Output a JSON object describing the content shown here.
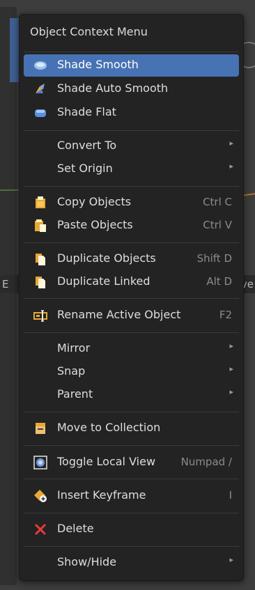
{
  "background": {
    "header_left": "E",
    "header_right": "ve"
  },
  "menu": {
    "title": "Object Context Menu",
    "items": [
      {
        "label": "Shade Smooth",
        "shortcut": "",
        "submenu": false,
        "icon": "shade-smooth-icon"
      },
      {
        "label": "Shade Auto Smooth",
        "shortcut": "",
        "submenu": false,
        "icon": "shade-auto-smooth-icon"
      },
      {
        "label": "Shade Flat",
        "shortcut": "",
        "submenu": false,
        "icon": "shade-flat-icon"
      },
      {
        "label": "Convert To",
        "shortcut": "",
        "submenu": true,
        "icon": ""
      },
      {
        "label": "Set Origin",
        "shortcut": "",
        "submenu": true,
        "icon": ""
      },
      {
        "label": "Copy Objects",
        "shortcut": "Ctrl C",
        "submenu": false,
        "icon": "copy-icon"
      },
      {
        "label": "Paste Objects",
        "shortcut": "Ctrl V",
        "submenu": false,
        "icon": "paste-icon"
      },
      {
        "label": "Duplicate Objects",
        "shortcut": "Shift D",
        "submenu": false,
        "icon": "duplicate-icon"
      },
      {
        "label": "Duplicate Linked",
        "shortcut": "Alt D",
        "submenu": false,
        "icon": "duplicate-linked-icon"
      },
      {
        "label": "Rename Active Object",
        "shortcut": "F2",
        "submenu": false,
        "icon": "rename-icon"
      },
      {
        "label": "Mirror",
        "shortcut": "",
        "submenu": true,
        "icon": ""
      },
      {
        "label": "Snap",
        "shortcut": "",
        "submenu": true,
        "icon": ""
      },
      {
        "label": "Parent",
        "shortcut": "",
        "submenu": true,
        "icon": ""
      },
      {
        "label": "Move to Collection",
        "shortcut": "",
        "submenu": false,
        "icon": "collection-icon"
      },
      {
        "label": "Toggle Local View",
        "shortcut": "Numpad /",
        "submenu": false,
        "icon": "local-view-icon"
      },
      {
        "label": "Insert Keyframe",
        "shortcut": "I",
        "submenu": false,
        "icon": "keyframe-icon"
      },
      {
        "label": "Delete",
        "shortcut": "",
        "submenu": false,
        "icon": "delete-icon"
      },
      {
        "label": "Show/Hide",
        "shortcut": "",
        "submenu": true,
        "icon": ""
      }
    ],
    "submenu_arrow": "▸",
    "active_index": 0
  }
}
